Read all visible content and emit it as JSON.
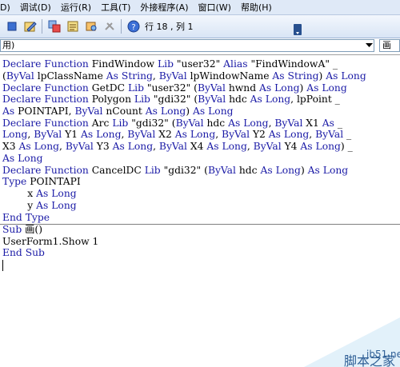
{
  "menu": [
    "D)",
    "调试(D)",
    "运行(R)",
    "工具(T)",
    "外接程序(A)",
    "窗口(W)",
    "帮助(H)"
  ],
  "toolbar": {
    "position_text": "行 18 , 列 1"
  },
  "combo": {
    "left": "用)",
    "right": "画"
  },
  "code_lines": [
    "Declare Function FindWindow Lib \"user32\" Alias \"FindWindowA\" _",
    "(ByVal lpClassName As String, ByVal lpWindowName As String) As Long",
    "Declare Function GetDC Lib \"user32\" (ByVal hwnd As Long) As Long",
    "Declare Function Polygon Lib \"gdi32\" (ByVal hdc As Long, lpPoint _",
    "As POINTAPI, ByVal nCount As Long) As Long",
    "Declare Function Arc Lib \"gdi32\" (ByVal hdc As Long, ByVal X1 As _",
    "Long, ByVal Y1 As Long, ByVal X2 As Long, ByVal Y2 As Long, ByVal _",
    "X3 As Long, ByVal Y3 As Long, ByVal X4 As Long, ByVal Y4 As Long) _",
    "As Long",
    "Declare Function CancelDC Lib \"gdi32\" (ByVal hdc As Long) As Long",
    "Type POINTAPI",
    "        x As Long",
    "        y As Long",
    "End Type",
    "Sub 画()",
    "UserForm1.Show 1",
    "End Sub"
  ],
  "watermark": {
    "site": "jb51.net",
    "name": "脚本之家"
  },
  "colors": {
    "keyword": "#1a1aa6",
    "text": "#000000",
    "toolbar": "#dfe9f7"
  }
}
